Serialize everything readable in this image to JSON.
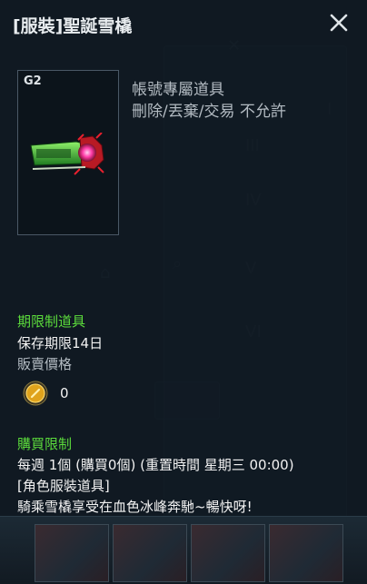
{
  "item": {
    "title": "[服裝]聖誕雪橇",
    "grade": "G2",
    "info_line1": "帳號專屬道具",
    "info_line2": "刪除/丟棄/交易 不允許"
  },
  "period": {
    "label": "期限制道具",
    "value": "保存期限14日"
  },
  "price": {
    "label": "販賣價格",
    "amount": "0"
  },
  "purchase": {
    "label": "購買限制",
    "weekly": "每週 1個 (購買0個) (重置時間 星期三 00:00)",
    "category": "[角色服裝道具]",
    "description": "騎乘雪橇享受在血色冰峰奔馳~暢快呀!"
  },
  "icons": {
    "close": "close-icon",
    "item": "christmas-sled-icon",
    "coin": "gold-coin-icon"
  },
  "colors": {
    "label_green": "#5cdc3c",
    "panel_bg": "#101821",
    "text_grey": "#b3bbc2",
    "coin_gold": "#e0a31c"
  }
}
